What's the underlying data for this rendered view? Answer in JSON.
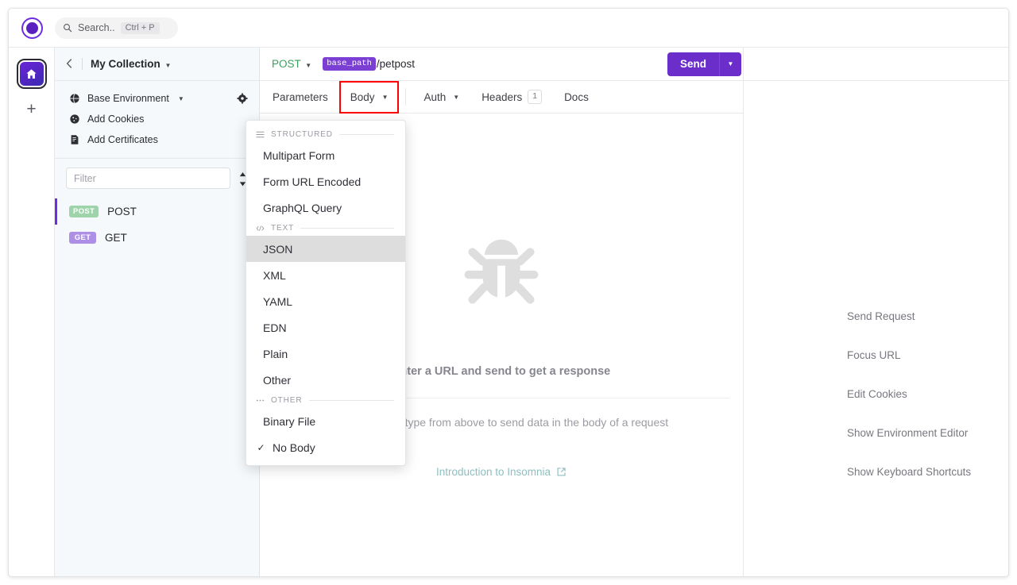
{
  "app": {
    "logo_icon": "insomnia-logo-icon"
  },
  "topbar": {
    "search_icon": "search-icon",
    "search_placeholder": "Search..",
    "search_shortcut": "Ctrl + P"
  },
  "rail": {
    "home_icon": "home-icon",
    "add_icon": "plus-icon"
  },
  "sidebar": {
    "back_icon": "chevron-left-icon",
    "collection_title": "My Collection",
    "collection_caret_icon": "chevron-down-icon",
    "settings_icon": "gear-icon",
    "rows": [
      {
        "icon": "globe-icon",
        "label": "Base Environment",
        "caret": true
      },
      {
        "icon": "cookie-icon",
        "label": "Add Cookies",
        "caret": false
      },
      {
        "icon": "certificate-icon",
        "label": "Add Certificates",
        "caret": false
      }
    ],
    "filter_placeholder": "Filter",
    "filter_value": "",
    "sort_icon": "sort-icon",
    "requests": [
      {
        "method": "POST",
        "label": "POST",
        "active": true
      },
      {
        "method": "GET",
        "label": "GET",
        "active": false
      }
    ]
  },
  "request": {
    "method": "POST",
    "method_caret_icon": "chevron-down-icon",
    "url_variable": "base_path",
    "url_path": "/petpost",
    "send_label": "Send",
    "send_caret_icon": "chevron-down-icon",
    "tabs": [
      {
        "label": "Parameters",
        "caret": false,
        "count": null,
        "selected": false
      },
      {
        "label": "Body",
        "caret": true,
        "count": null,
        "selected": true
      },
      {
        "label": "Auth",
        "caret": true,
        "count": null,
        "selected": false
      },
      {
        "label": "Headers",
        "caret": false,
        "count": "1",
        "selected": false
      },
      {
        "label": "Docs",
        "caret": false,
        "count": null,
        "selected": false
      }
    ]
  },
  "body_menu": {
    "sections": [
      {
        "icon": "list-icon",
        "title": "STRUCTURED",
        "items": [
          {
            "label": "Multipart Form",
            "highlighted": false,
            "checked": false
          },
          {
            "label": "Form URL Encoded",
            "highlighted": false,
            "checked": false
          },
          {
            "label": "GraphQL Query",
            "highlighted": false,
            "checked": false
          }
        ]
      },
      {
        "icon": "code-icon",
        "title": "TEXT",
        "items": [
          {
            "label": "JSON",
            "highlighted": true,
            "checked": false
          },
          {
            "label": "XML",
            "highlighted": false,
            "checked": false
          },
          {
            "label": "YAML",
            "highlighted": false,
            "checked": false
          },
          {
            "label": "EDN",
            "highlighted": false,
            "checked": false
          },
          {
            "label": "Plain",
            "highlighted": false,
            "checked": false
          },
          {
            "label": "Other",
            "highlighted": false,
            "checked": false
          }
        ]
      },
      {
        "icon": "ellipsis-icon",
        "title": "OTHER",
        "items": [
          {
            "label": "Binary File",
            "highlighted": false,
            "checked": false
          },
          {
            "label": "No Body",
            "highlighted": false,
            "checked": true
          }
        ]
      }
    ]
  },
  "response_empty": {
    "bug_icon": "bug-icon",
    "heading": "Enter a URL and send to get a response",
    "subtext": "Select a body type from above to send data in the body of a request",
    "link_label": "Introduction to Insomnia",
    "link_icon": "external-link-icon"
  },
  "shortcuts": {
    "items": [
      "Send Request",
      "Focus URL",
      "Edit Cookies",
      "Show Environment Editor",
      "Show Keyboard Shortcuts"
    ]
  },
  "colors": {
    "accent_purple": "#6b2ecb",
    "method_post_green": "#3b9e5e",
    "tag_post": "#9fd4ab",
    "tag_get": "#ae8fe6",
    "variable_chip": "#7b3fd4",
    "annotation_red": "#ff0000",
    "link_teal": "#8dbfc0"
  }
}
